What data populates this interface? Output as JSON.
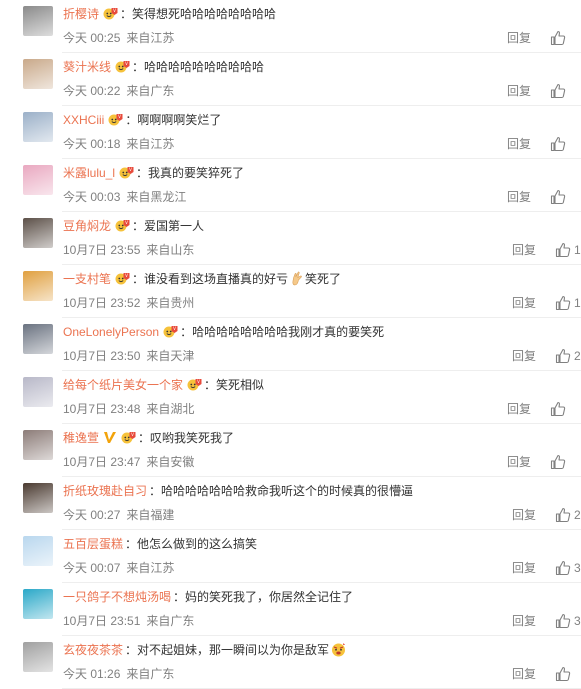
{
  "ui": {
    "reply_label": "回复"
  },
  "comments": [
    {
      "user": "折樱诗",
      "text": "笑得想死哈哈哈哈哈哈哈哈",
      "time": "今天 00:25",
      "source": "来自江苏",
      "like_count": "",
      "avatar_color": "#8a8a8a",
      "has_vip": true
    },
    {
      "user": "葵汁米线",
      "text": "哈哈哈哈哈哈哈哈哈哈",
      "time": "今天 00:22",
      "source": "来自广东",
      "like_count": "",
      "avatar_color": "#c9a98a",
      "has_vip": true
    },
    {
      "user": "XXHCiii",
      "text": "啊啊啊啊笑烂了",
      "time": "今天 00:18",
      "source": "来自江苏",
      "like_count": "",
      "avatar_color": "#9bb0c8",
      "has_vip": true
    },
    {
      "user": "米露lulu_l",
      "text": "我真的要笑猝死了",
      "time": "今天 00:03",
      "source": "来自黑龙江",
      "like_count": "",
      "avatar_color": "#e9a8c0",
      "has_vip": true
    },
    {
      "user": "豆角焖龙",
      "text": "爱国第一人",
      "time": "10月7日 23:55",
      "source": "来自山东",
      "like_count": "1",
      "avatar_color": "#5c5048",
      "has_vip": true
    },
    {
      "user": "一支村笔",
      "text": "谁没看到这场直播真的好亏",
      "text_after": "笑死了",
      "time": "10月7日 23:52",
      "source": "来自贵州",
      "like_count": "1",
      "avatar_color": "#e0a040",
      "has_vip": true
    },
    {
      "user": "OneLonelyPerson",
      "text": "哈哈哈哈哈哈哈哈我刚才真的要笑死",
      "time": "10月7日 23:50",
      "source": "来自天津",
      "like_count": "2",
      "avatar_color": "#6a7280",
      "has_vip": true
    },
    {
      "user": "给每个纸片美女一个家",
      "text": "笑死相似",
      "time": "10月7日 23:48",
      "source": "来自湖北",
      "like_count": "",
      "avatar_color": "#b8b8c8",
      "has_vip": true
    },
    {
      "user": "稚逸萱",
      "text": "叹哟我笑死我了",
      "time": "10月7日 23:47",
      "source": "来自安徽",
      "like_count": "",
      "avatar_color": "#8c7c78",
      "has_vip": true,
      "has_v": true
    },
    {
      "user": "折纸玫瑰赴自习",
      "text": "哈哈哈哈哈哈哈救命我听这个的时候真的很懵逼",
      "time": "今天 00:27",
      "source": "来自福建",
      "like_count": "2",
      "avatar_color": "#4a3a30",
      "has_vip": false
    },
    {
      "user": "五百层蛋糕",
      "text": "他怎么做到的这么搞笑",
      "time": "今天 00:07",
      "source": "来自江苏",
      "like_count": "3",
      "avatar_color": "#b9d7ee",
      "has_vip": false
    },
    {
      "user": "一只鸽子不想炖汤喝",
      "text": "妈的笑死我了，你居然全记住了",
      "time": "10月7日 23:51",
      "source": "来自广东",
      "like_count": "3",
      "avatar_color": "#2aa8c8",
      "has_vip": false
    },
    {
      "user": "玄夜夜茶茶",
      "text": "对不起姐妹，那一瞬间以为你是敌军",
      "time": "今天 01:26",
      "source": "来自广东",
      "like_count": "",
      "avatar_color": "#a0a0a0",
      "has_vip": false,
      "has_emoji": true
    }
  ]
}
